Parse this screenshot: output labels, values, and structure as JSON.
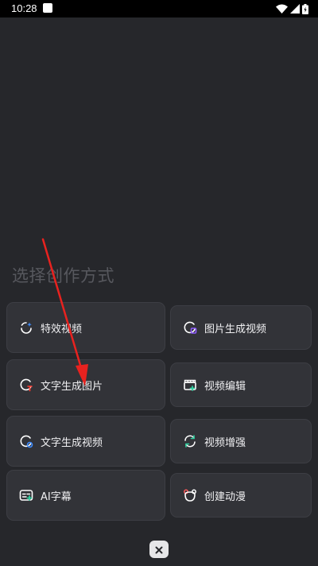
{
  "status_bar": {
    "time": "10:28"
  },
  "section_title": "选择创作方式",
  "options": [
    {
      "label": "特效视频",
      "icon": "sparkle-refresh-icon"
    },
    {
      "label": "图片生成视频",
      "icon": "image-to-video-icon"
    },
    {
      "label": "文字生成图片",
      "icon": "text-to-image-icon"
    },
    {
      "label": "视频编辑",
      "icon": "clapperboard-icon"
    },
    {
      "label": "文字生成视频",
      "icon": "text-to-video-icon"
    },
    {
      "label": "视频增强",
      "icon": "enhance-icon"
    },
    {
      "label": "AI字幕",
      "icon": "subtitle-icon"
    },
    {
      "label": "创建动漫",
      "icon": "anime-bear-icon"
    }
  ],
  "colors": {
    "background": "#26272b",
    "tile": "#323338",
    "accent_purple": "#8f5cff",
    "accent_green": "#2fd1a0",
    "accent_red": "#ff3b30",
    "accent_blue": "#3d8bff",
    "annotation_arrow": "#e8221f"
  }
}
